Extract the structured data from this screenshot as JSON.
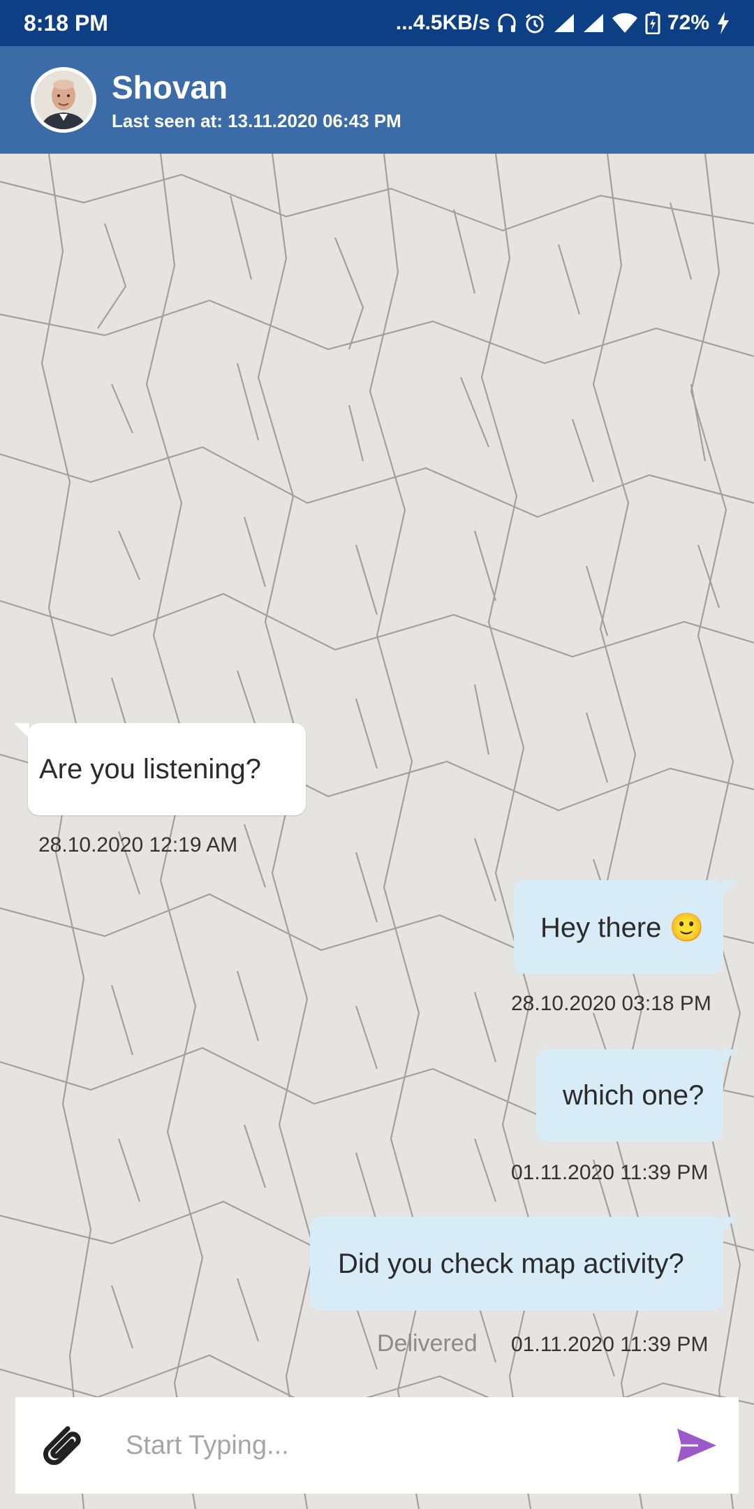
{
  "status_bar": {
    "time": "8:18 PM",
    "network_speed": "...4.5KB/s",
    "battery": "72%",
    "icons": [
      "headphones-icon",
      "alarm-icon",
      "signal-icon",
      "signal-icon",
      "wifi-icon",
      "battery-icon",
      "charging-icon"
    ]
  },
  "header": {
    "contact_name": "Shovan",
    "last_seen": "Last seen at: 13.11.2020 06:43 PM",
    "avatar_icon": "avatar"
  },
  "messages": [
    {
      "direction": "in",
      "text": "Are you listening?",
      "time": "28.10.2020 12:19 AM"
    },
    {
      "direction": "out",
      "text": "Hey there 🙂",
      "time": "28.10.2020 03:18 PM"
    },
    {
      "direction": "out",
      "text": "which one?",
      "time": "01.11.2020 11:39 PM"
    },
    {
      "direction": "out",
      "text": "Did you check map activity?",
      "time": "01.11.2020 11:39 PM",
      "status": "Delivered"
    }
  ],
  "composer": {
    "placeholder": "Start Typing...",
    "value": "",
    "attach_icon": "paperclip-icon",
    "send_icon": "send-icon"
  },
  "colors": {
    "status_bar": "#0d3f85",
    "header": "#3b6ca8",
    "incoming_bubble": "#ffffff",
    "outgoing_bubble": "#d8ecf8",
    "send_accent": "#9b59c9"
  }
}
